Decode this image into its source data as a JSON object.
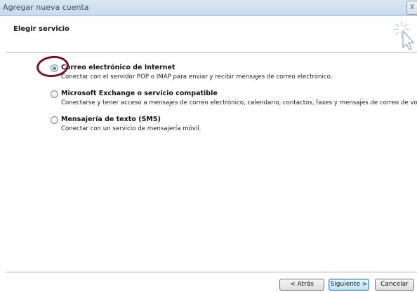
{
  "window": {
    "title": "Agregar nueva cuenta",
    "close_label": "X"
  },
  "header": {
    "heading": "Elegir servicio",
    "icon": "wizard-sparkle-cursor-icon"
  },
  "options": [
    {
      "label": "Correo electrónico de Internet",
      "description": "Conectar con el servidor POP o IMAP para enviar y recibir mensajes de correo electrónico.",
      "selected": true
    },
    {
      "label": "Microsoft Exchange o servicio compatible",
      "description": "Conectarse y tener acceso a mensajes de correo electrónico, calendario, contactos, faxes y mensajes de correo de voz.",
      "selected": false
    },
    {
      "label": "Mensajería de texto (SMS)",
      "description": "Conectar con un servicio de mensajería móvil.",
      "selected": false
    }
  ],
  "annotation": {
    "circle_color": "#7a1020"
  },
  "buttons": {
    "back": "< Atrás",
    "next": "Siguiente >",
    "cancel": "Cancelar"
  },
  "colors": {
    "accent": "#3c7fb1",
    "radio_fill": "#1f5fa8"
  }
}
